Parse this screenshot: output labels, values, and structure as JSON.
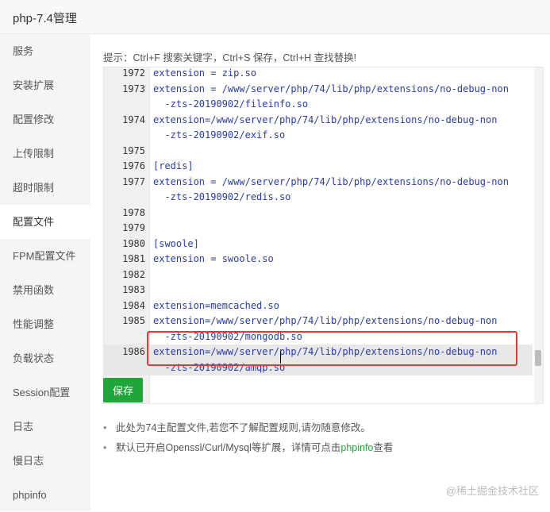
{
  "window": {
    "title": "php-7.4管理"
  },
  "sidebar": {
    "items": [
      {
        "label": "服务"
      },
      {
        "label": "安装扩展"
      },
      {
        "label": "配置修改"
      },
      {
        "label": "上传限制"
      },
      {
        "label": "超时限制"
      },
      {
        "label": "配置文件",
        "active": true
      },
      {
        "label": "FPM配置文件"
      },
      {
        "label": "禁用函数"
      },
      {
        "label": "性能调整"
      },
      {
        "label": "负载状态"
      },
      {
        "label": "Session配置"
      },
      {
        "label": "日志"
      },
      {
        "label": "慢日志"
      },
      {
        "label": "phpinfo"
      }
    ]
  },
  "main": {
    "hint": "提示：Ctrl+F 搜索关键字，Ctrl+S 保存，Ctrl+H 查找替换!",
    "editor": {
      "rows": [
        {
          "num": "1972",
          "code": "extension = zip.so"
        },
        {
          "num": "1973",
          "code": "extension = /www/server/php/74/lib/php/extensions/no-debug-non"
        },
        {
          "num": "",
          "code": "  -zts-20190902/fileinfo.so"
        },
        {
          "num": "1974",
          "code": "extension=/www/server/php/74/lib/php/extensions/no-debug-non"
        },
        {
          "num": "",
          "code": "  -zts-20190902/exif.so"
        },
        {
          "num": "1975",
          "code": ""
        },
        {
          "num": "1976",
          "code": "[redis]"
        },
        {
          "num": "1977",
          "code": "extension = /www/server/php/74/lib/php/extensions/no-debug-non"
        },
        {
          "num": "",
          "code": "  -zts-20190902/redis.so"
        },
        {
          "num": "1978",
          "code": ""
        },
        {
          "num": "1979",
          "code": ""
        },
        {
          "num": "1980",
          "code": "[swoole]"
        },
        {
          "num": "1981",
          "code": "extension = swoole.so"
        },
        {
          "num": "1982",
          "code": ""
        },
        {
          "num": "1983",
          "code": ""
        },
        {
          "num": "1984",
          "code": "extension=memcached.so"
        },
        {
          "num": "1985",
          "code": "extension=/www/server/php/74/lib/php/extensions/no-debug-non"
        },
        {
          "num": "",
          "code": "  -zts-20190902/mongodb.so"
        },
        {
          "num": "1986",
          "code": "extension=/www/server/php/74/lib/php/extensions/no-debug-non",
          "current": true
        },
        {
          "num": "",
          "code": "  -zts-20190902/amqp.so",
          "current": true
        }
      ]
    },
    "save_label": "保存",
    "notes": {
      "note1": "此处为74主配置文件,若您不了解配置规则,请勿随意修改。",
      "note2_before": "默认已开启Openssl/Curl/Mysql等扩展，详情可点击",
      "note2_link": "phpinfo",
      "note2_after": "查看"
    }
  },
  "watermark": "@稀土掘金技术社区",
  "colors": {
    "accent": "#20a53a",
    "code": "#2a3ba8",
    "highlight_border": "#e53935",
    "sidebar_bg": "#f5f5f5"
  }
}
